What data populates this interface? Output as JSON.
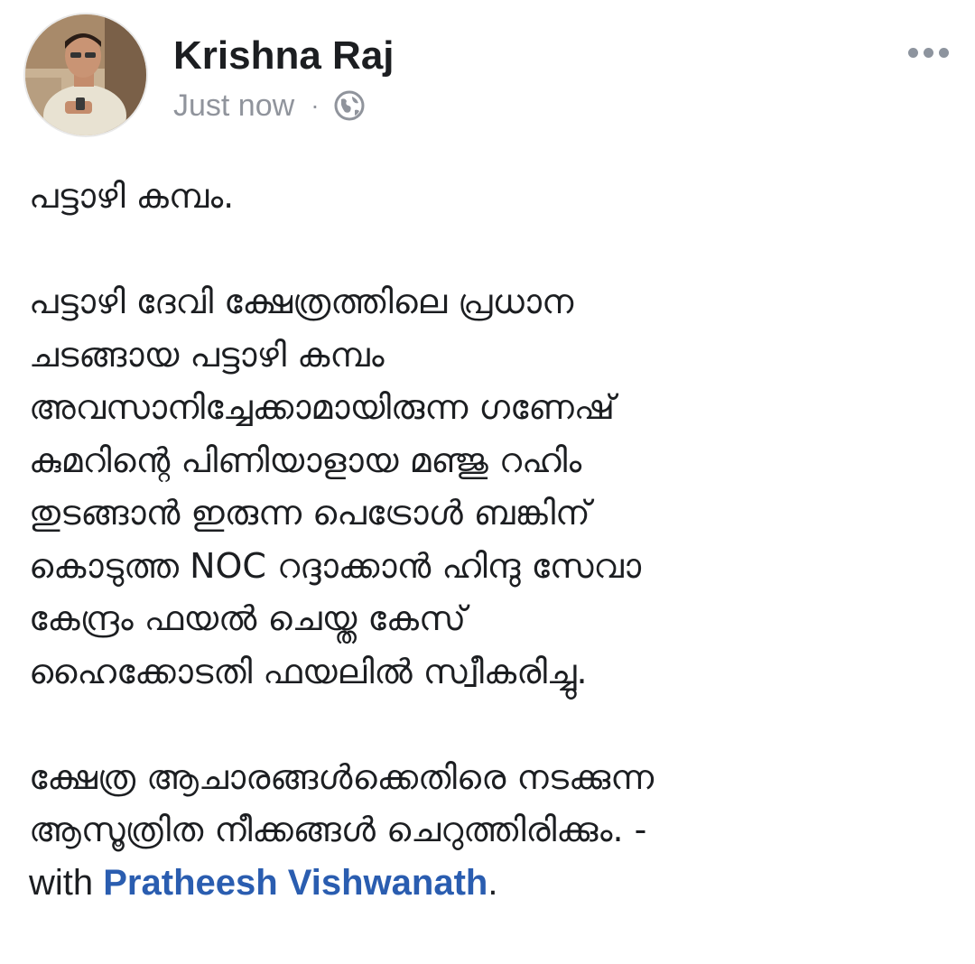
{
  "post": {
    "author_name": "Krishna Raj",
    "timestamp": "Just now",
    "separator": "·",
    "audience_icon": "globe-icon",
    "more_icon": "more-horizontal-icon",
    "body": {
      "title_line": "പട്ടാഴി കമ്പം.",
      "paragraph_1_lines": [
        "പട്ടാഴി ദേവി ക്ഷേത്രത്തിലെ പ്രധാന",
        "ചടങ്ങായ പട്ടാഴി കമ്പം",
        "അവസാനിച്ചേക്കാമായിരുന്ന  ഗണേഷ്",
        "കുമറിന്റെ പിണിയാളായ മഞ്ജു റഹിം",
        "തുടങ്ങാൻ ഇരുന്ന പെട്രോൾ ബങ്കിന്",
        "കൊടുത്ത NOC റദ്ദാക്കാൻ ഹിന്ദു സേവാ",
        "കേന്ദ്രം ഫയൽ ചെയ്ത കേസ്",
        "ഹൈക്കോടതി ഫയലിൽ സ്വീകരിച്ചു."
      ],
      "paragraph_2_lines": [
        "ക്ഷേത്ര ആചാരങ്ങൾക്കെതിരെ നടക്കുന്ന",
        "ആസൂത്രിത നീക്കങ്ങൾ ചെറുത്തിരിക്കും. -"
      ],
      "with_prefix": "with ",
      "tagged_person": "Pratheesh Vishwanath",
      "with_suffix": "."
    }
  },
  "colors": {
    "text": "#1c1e21",
    "meta": "#90949c",
    "link": "#2a5db0",
    "background": "#ffffff"
  }
}
